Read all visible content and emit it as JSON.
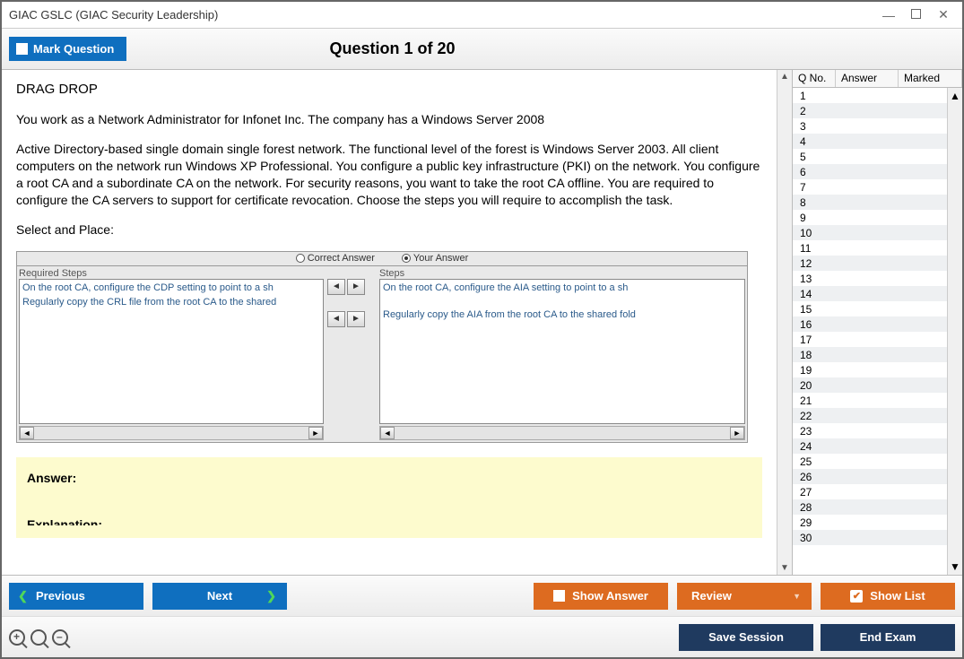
{
  "window": {
    "title": "GIAC GSLC (GIAC Security Leadership)"
  },
  "header": {
    "mark_label": "Mark Question",
    "counter": "Question 1 of 20"
  },
  "question": {
    "type_label": "DRAG DROP",
    "intro": "You work as a Network Administrator for Infonet Inc. The company has a Windows Server 2008",
    "body": "Active Directory-based single domain single forest network. The functional level of the forest is Windows Server 2003. All client computers on the network run Windows XP Professional. You configure a public key infrastructure (PKI) on the network. You configure a root CA and a subordinate CA on the network. For security reasons, you want to take the root CA offline. You are required to configure the CA servers to support for certificate revocation. Choose the steps you will require to accomplish the task.",
    "select_label": "Select and Place:"
  },
  "drag": {
    "correct_radio": "Correct Answer",
    "your_radio": "Your Answer",
    "required_label": "Required Steps",
    "steps_label": "Steps",
    "left_items": [
      "On the root CA, configure the CDP setting to point to a sh",
      "Regularly copy the CRL file from the root CA to the shared"
    ],
    "right_items": [
      "On the root CA, configure the AIA setting to point to a sh",
      "",
      "Regularly copy the AIA from the root CA to the shared fold"
    ]
  },
  "answer_box": {
    "answer_label": "Answer:",
    "explanation_label": "Explanation:"
  },
  "sidebar": {
    "headers": {
      "qno": "Q No.",
      "answer": "Answer",
      "marked": "Marked"
    },
    "rows": [
      1,
      2,
      3,
      4,
      5,
      6,
      7,
      8,
      9,
      10,
      11,
      12,
      13,
      14,
      15,
      16,
      17,
      18,
      19,
      20,
      21,
      22,
      23,
      24,
      25,
      26,
      27,
      28,
      29,
      30
    ]
  },
  "footer": {
    "previous": "Previous",
    "next": "Next",
    "show_answer": "Show Answer",
    "review": "Review",
    "show_list": "Show List",
    "save_session": "Save Session",
    "end_exam": "End Exam"
  }
}
